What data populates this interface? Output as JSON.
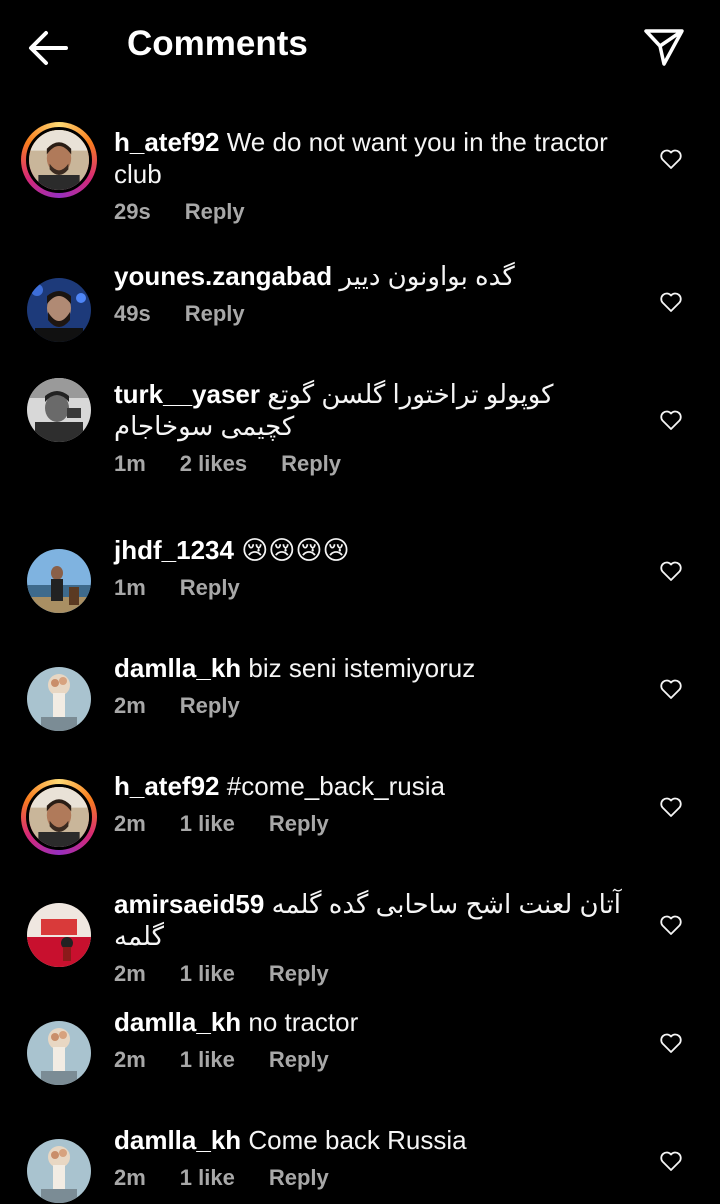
{
  "header": {
    "title": "Comments"
  },
  "comments": [
    {
      "username": "h_atef92",
      "text": "We do not want you in the tractor club",
      "time": "29s",
      "likes": "",
      "reply": "Reply",
      "story": true
    },
    {
      "username": "younes.zangabad",
      "text": "گده بواونون دییر",
      "time": "49s",
      "likes": "",
      "reply": "Reply",
      "story": false
    },
    {
      "username": "turk__yaser",
      "text": "کوپولو تراختورا گلسن گوتع کچیمی سوخاجام",
      "time": "1m",
      "likes": "2 likes",
      "reply": "Reply",
      "story": false
    },
    {
      "username": "jhdf_1234",
      "text": "😢😢😢😢",
      "time": "1m",
      "likes": "",
      "reply": "Reply",
      "story": false
    },
    {
      "username": "damlla_kh",
      "text": "biz seni istemiyoruz",
      "time": "2m",
      "likes": "",
      "reply": "Reply",
      "story": false
    },
    {
      "username": "h_atef92",
      "text": "#come_back_rusia",
      "time": "2m",
      "likes": "1 like",
      "reply": "Reply",
      "story": true
    },
    {
      "username": "amirsaeid59",
      "text": "آتان لعنت اشح ساحابی گده گلمه گلمه",
      "time": "2m",
      "likes": "1 like",
      "reply": "Reply",
      "story": false
    },
    {
      "username": "damlla_kh",
      "text": "no tractor",
      "time": "2m",
      "likes": "1 like",
      "reply": "Reply",
      "story": false
    },
    {
      "username": "damlla_kh",
      "text": "Come back Russia",
      "time": "2m",
      "likes": "1 like",
      "reply": "Reply",
      "story": false
    }
  ],
  "colors": {
    "background": "#000000",
    "text": "#f5f5f5",
    "secondary": "#a8a8a8"
  },
  "icons": {
    "back": "arrow-left-icon",
    "share": "paper-plane-icon",
    "like": "heart-outline-icon"
  }
}
